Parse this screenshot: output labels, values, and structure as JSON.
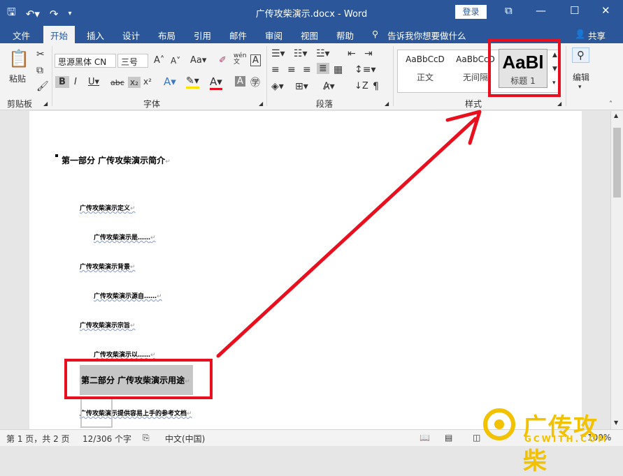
{
  "app": {
    "document_title": "广传攻柴演示.docx - Word",
    "login_label": "登录",
    "share_label": "共享",
    "tell_me_placeholder": "告诉我你想要做什么"
  },
  "tabs": [
    "文件",
    "开始",
    "插入",
    "设计",
    "布局",
    "引用",
    "邮件",
    "审阅",
    "视图",
    "帮助"
  ],
  "active_tab": "开始",
  "ribbon": {
    "clipboard": {
      "paste_label": "粘贴",
      "group_label": "剪贴板"
    },
    "font": {
      "font_name": "思源黑体 CN",
      "font_size": "三号",
      "group_label": "字体",
      "wen_label": "wén文"
    },
    "paragraph": {
      "group_label": "段落"
    },
    "styles": {
      "group_label": "样式",
      "items": [
        {
          "preview": "AaBbCcD",
          "name": "正文"
        },
        {
          "preview": "AaBbCcD",
          "name": "无间隔"
        }
      ],
      "selected": {
        "preview": "AaBl",
        "name": "标题 1"
      }
    },
    "editing": {
      "label": "编辑"
    }
  },
  "document": {
    "lines": [
      {
        "text": "第一部分  广传攻柴演示简介",
        "level": "h1"
      },
      {
        "text": "广传攻柴演示定义",
        "level": "h2"
      },
      {
        "text": "广传攻柴演示是……",
        "level": "h3"
      },
      {
        "text": "广传攻柴演示背景",
        "level": "h2"
      },
      {
        "text": "广传攻柴演示源自……",
        "level": "h3"
      },
      {
        "text": "广传攻柴演示宗旨",
        "level": "h2"
      },
      {
        "text": "广传攻柴演示以……",
        "level": "h3"
      },
      {
        "text": "第二部分  广传攻柴演示用途",
        "level": "h1",
        "selected": true
      },
      {
        "text": "广传攻柴演示提供容易上手的参考文档",
        "level": "h2"
      }
    ]
  },
  "status": {
    "page": "第 1 页，共 2 页",
    "words": "12/306 个字",
    "language": "中文(中国)",
    "zoom": "100%"
  },
  "watermark": {
    "text": "广传攻柴",
    "url": "GCWITH.COM"
  },
  "colors": {
    "brand": "#2b579a",
    "highlight": "#e8101e"
  }
}
